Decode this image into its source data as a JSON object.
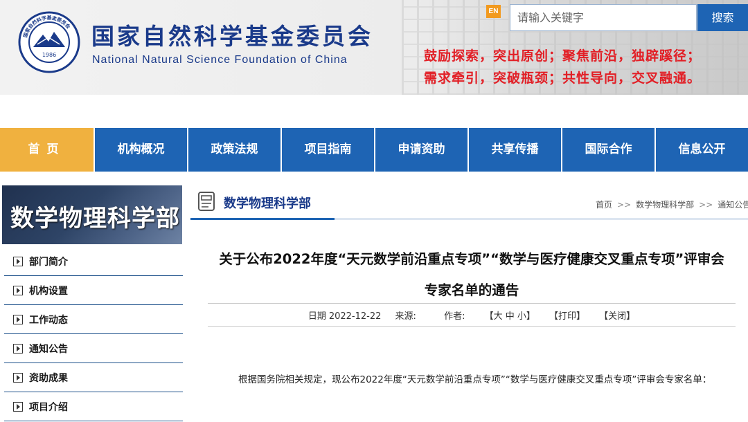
{
  "header": {
    "org_name_cn": "国家自然科学基金委员会",
    "org_name_en": "National Natural Science Foundation of China",
    "logo_ring_text": "国家自然科学基金委员会",
    "logo_year": "1986",
    "lang_button": "EN",
    "search_placeholder": "请输入关键字",
    "search_button": "搜索",
    "slogan_line1": "鼓励探索，突出原创；聚焦前沿，独辟蹊径；",
    "slogan_line2": "需求牵引，突破瓶颈；共性导向，交叉融通。"
  },
  "nav": {
    "items": [
      {
        "label": "首页",
        "active": true
      },
      {
        "label": "机构概况"
      },
      {
        "label": "政策法规"
      },
      {
        "label": "项目指南"
      },
      {
        "label": "申请资助"
      },
      {
        "label": "共享传播"
      },
      {
        "label": "国际合作"
      },
      {
        "label": "信息公开"
      }
    ]
  },
  "sidebar": {
    "banner_title": "数学物理科学部",
    "items": [
      {
        "label": "部门简介"
      },
      {
        "label": "机构设置"
      },
      {
        "label": "工作动态"
      },
      {
        "label": "通知公告"
      },
      {
        "label": "资助成果"
      },
      {
        "label": "项目介绍"
      }
    ]
  },
  "column": {
    "title": "数学物理科学部",
    "breadcrumb": [
      "首页",
      "数学物理科学部",
      "通知公告"
    ],
    "breadcrumb_sep": ">>"
  },
  "article": {
    "title": "关于公布2022年度“天元数学前沿重点专项”“数学与医疗健康交叉重点专项”评审会专家名单的通告",
    "date_label": "日期",
    "date": "2022-12-22",
    "source_label": "来源:",
    "author_label": "作者:",
    "font_size_control": "【大 中 小】",
    "print_link": "【打印】",
    "close_link": "【关闭】",
    "body": "根据国务院相关规定，现公布2022年度“天元数学前沿重点专项”“数学与医疗健康交叉重点专项”评审会专家名单："
  },
  "colors": {
    "primary_blue": "#1e64b4",
    "active_orange": "#f0b13f",
    "slogan_red": "#e21f26",
    "en_orange": "#f29a1f"
  }
}
